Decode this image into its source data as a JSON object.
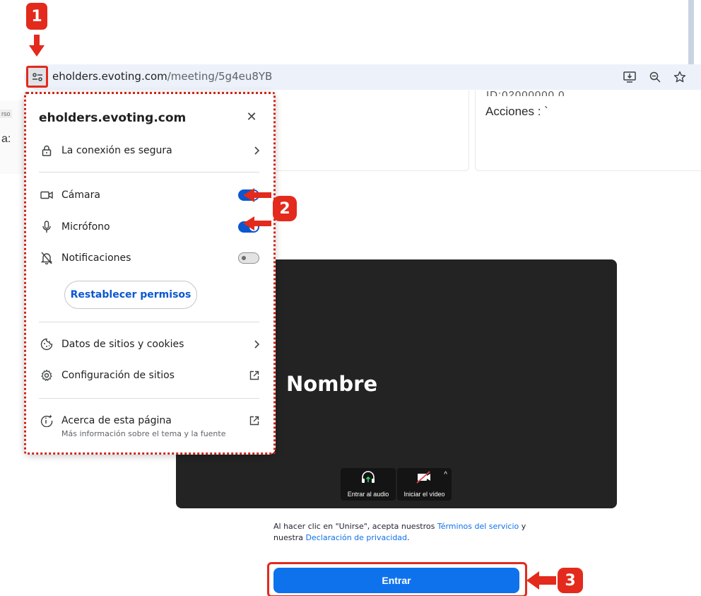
{
  "browser": {
    "url_domain": "eholders.evoting.com",
    "url_path": "/meeting/5g4eu8YB",
    "icons": [
      "site-settings-icon",
      "install-app-icon",
      "zoom-icon",
      "bookmark-star-icon"
    ]
  },
  "background_page": {
    "left_tag": "rso",
    "left_colon": "a:",
    "acciones_label": "Acciones : `",
    "video": {
      "name": "Nombre",
      "audio_label": "Entrar al audio",
      "video_label": "Iniciar el vídeo"
    },
    "terms": {
      "part1": "Al hacer clic en \"Unirse\", acepta nuestros ",
      "terms_link": "Términos del servicio",
      "part2": " y nuestra ",
      "privacy_link": "Declaración de privacidad",
      "part3": "."
    },
    "join_button": "Entrar"
  },
  "site_info_popup": {
    "title": "eholders.evoting.com",
    "connection": "La conexión es segura",
    "permissions": [
      {
        "label": "Cámara",
        "enabled": true
      },
      {
        "label": "Micrófono",
        "enabled": true
      },
      {
        "label": "Notificaciones",
        "enabled": false
      }
    ],
    "reset_button": "Restablecer permisos",
    "cookies": "Datos de sitios y cookies",
    "site_settings": "Configuración de sitios",
    "about": "Acerca de esta página",
    "about_sub": "Más información sobre el tema y la fuente"
  },
  "annotations": {
    "step1": "1",
    "step2": "2",
    "step3": "3",
    "color": "#e32a1c"
  }
}
